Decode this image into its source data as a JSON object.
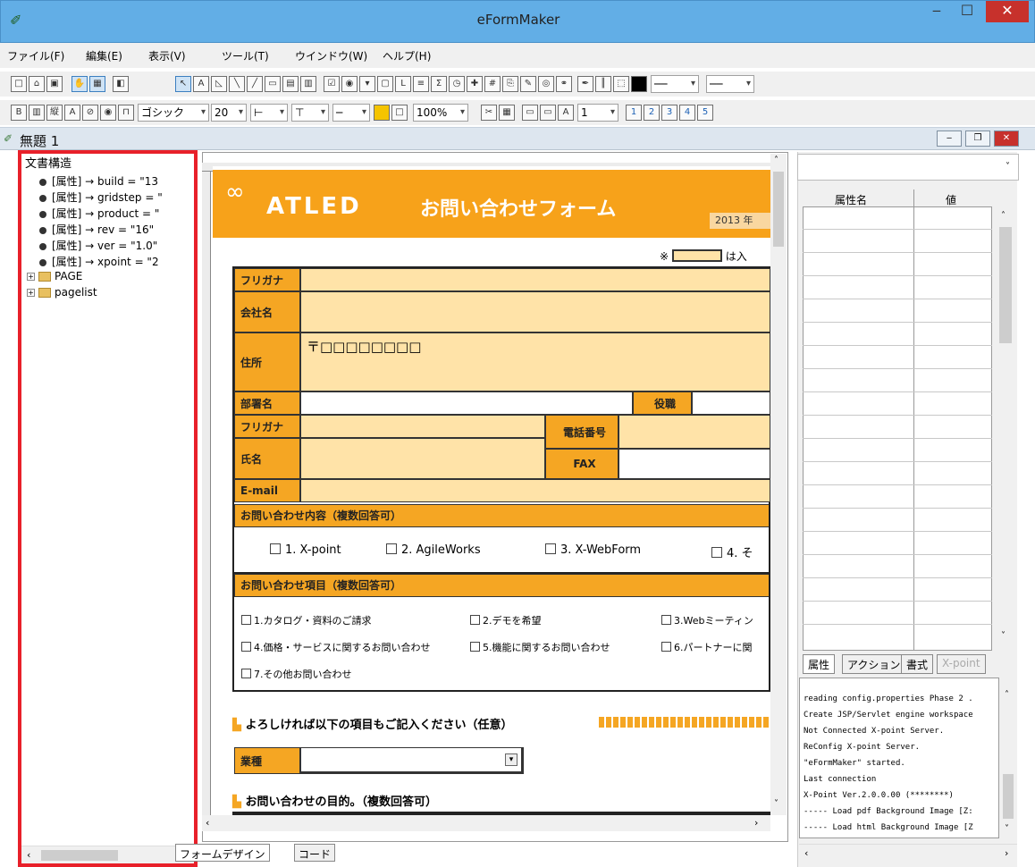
{
  "window": {
    "title": "eFormMaker",
    "minimize": "‒",
    "maximize": "☐",
    "close": "✕"
  },
  "menu": [
    "ファイル(F)",
    "編集(E)",
    "表示(V)",
    "ツール(T)",
    "ウインドウ(W)",
    "ヘルプ(H)"
  ],
  "toolbar2": {
    "font": "ゴシック",
    "size": "20",
    "zoom": "100%",
    "page": "1"
  },
  "document": {
    "title": "無題 1"
  },
  "tree": {
    "title": "文書構造",
    "attrs": [
      "[属性] → build = \"13",
      "[属性] → gridstep = \"",
      "[属性] → product = \"",
      "[属性] → rev = \"16\"",
      "[属性] → ver = \"1.0\"",
      "[属性] → xpoint = \"2"
    ],
    "folders": [
      "PAGE",
      "pagelist"
    ]
  },
  "form": {
    "logo": "ATLED",
    "title": "お問い合わせフォーム",
    "year": "2013 年",
    "note_prefix": "※",
    "note_suffix": "は入",
    "labels": {
      "kana": "フリガナ",
      "company": "会社名",
      "address": "住所",
      "dept": "部署名",
      "post": "役職",
      "kana2": "フリガナ",
      "tel": "電話番号",
      "name": "氏名",
      "fax": "FAX",
      "email": "E-mail"
    },
    "postal": "〒□□□□□□□□",
    "section1": "お問い合わせ内容（複数回答可）",
    "products": [
      "1. X-point",
      "2. AgileWorks",
      "3. X-WebForm",
      "4. そ"
    ],
    "section2": "お問い合わせ項目（複数回答可）",
    "items": [
      "1.カタログ・資料のご請求",
      "2.デモを希望",
      "3.Webミーティン",
      "4.価格・サービスに関するお問い合わせ",
      "5.機能に関するお問い合わせ",
      "6.パートナーに関",
      "7.その他お問い合わせ"
    ],
    "optional": "よろしければ以下の項目もご記入ください（任意）",
    "industry": "業種",
    "purpose": "お問い合わせの目的。（複数回答可）"
  },
  "tabs": {
    "design": "フォームデザイン",
    "code": "コード"
  },
  "props": {
    "col_name": "属性名",
    "col_value": "値",
    "tabs": [
      "属性",
      "アクション",
      "書式",
      "X-point"
    ]
  },
  "log": [
    "reading config.properties Phase 2 .",
    "Create JSP/Servlet engine workspace",
    "Not Connected X-point Server.",
    "ReConfig X-point Server.",
    "\"eFormMaker\" started.",
    "  Last connection",
    "  X-Point Ver.2.0.0.00 (********)",
    "----- Load pdf Background Image [Z:",
    "----- Load html Background Image [Z"
  ],
  "colors": {
    "accent": "#f5a623",
    "field": "#ffe3a8",
    "highlight": "#e8202a",
    "titlebar": "#62aee6"
  }
}
